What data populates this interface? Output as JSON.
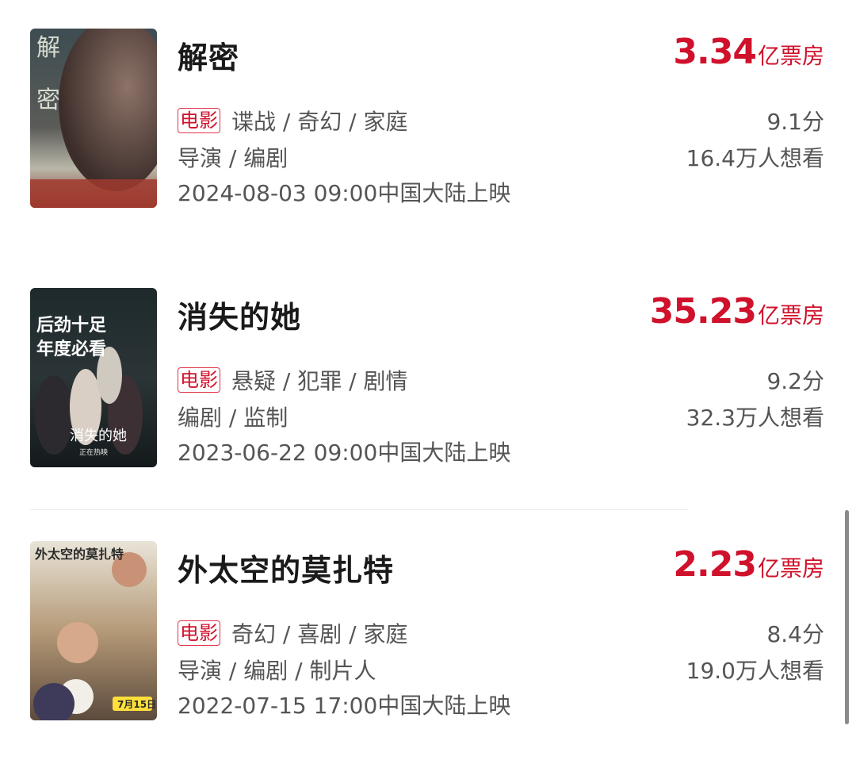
{
  "movies": [
    {
      "title": "解密",
      "box_office_value": "3.34",
      "box_office_unit": "亿票房",
      "badge": "电影",
      "genres": "谍战 / 奇幻 / 家庭",
      "score": "9.1分",
      "roles": "导演 / 编剧",
      "wish": "16.4万人想看",
      "release": "2024-08-03 09:00中国大陆上映",
      "poster_icon": "movie-poster-jiemi",
      "poster_text": [
        "解",
        "密"
      ]
    },
    {
      "title": "消失的她",
      "box_office_value": "35.23",
      "box_office_unit": "亿票房",
      "badge": "电影",
      "genres": "悬疑 / 犯罪 / 剧情",
      "score": "9.2分",
      "roles": "编剧 / 监制",
      "wish": "32.3万人想看",
      "release": "2023-06-22 09:00中国大陆上映",
      "poster_icon": "movie-poster-xiaoshi-de-ta",
      "poster_text": [
        "后劲十足",
        "年度必看",
        "消失的她",
        "正在热映"
      ]
    },
    {
      "title": "外太空的莫扎特",
      "box_office_value": "2.23",
      "box_office_unit": "亿票房",
      "badge": "电影",
      "genres": "奇幻 / 喜剧 / 家庭",
      "score": "8.4分",
      "roles": "导演 / 编剧 / 制片人",
      "wish": "19.0万人想看",
      "release": "2022-07-15 17:00中国大陆上映",
      "poster_icon": "movie-poster-waitaikong-de-mozhate",
      "poster_text": [
        "外太空的莫扎特",
        "7月15日"
      ]
    }
  ],
  "colors": {
    "accent_red": "#d0112b",
    "text_primary": "#1a1a1a",
    "text_secondary": "#555555"
  }
}
